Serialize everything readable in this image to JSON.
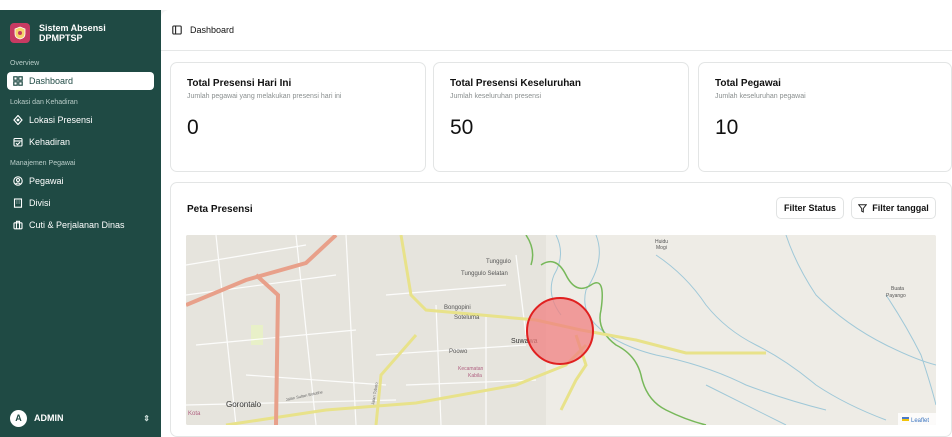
{
  "sidebar": {
    "app_title_line1": "Sistem Absensi",
    "app_title_line2": "DPMPTSP",
    "sections": {
      "overview": "Overview",
      "lokasi": "Lokasi dan Kehadiran",
      "manajemen": "Manajemen Pegawai"
    },
    "items": {
      "dashboard": "Dashboard",
      "lokasi_presensi": "Lokasi Presensi",
      "kehadiran": "Kehadiran",
      "pegawai": "Pegawai",
      "divisi": "Divisi",
      "cuti": "Cuti & Perjalanan Dinas"
    },
    "user": {
      "initial": "A",
      "name": "ADMIN"
    }
  },
  "header": {
    "breadcrumb": "Dashboard"
  },
  "stats": [
    {
      "title": "Total Presensi Hari Ini",
      "subtitle": "Jumlah pegawai yang melakukan presensi hari ini",
      "value": "0"
    },
    {
      "title": "Total Presensi Keseluruhan",
      "subtitle": "Jumlah keseluruhan presensi",
      "value": "50"
    },
    {
      "title": "Total Pegawai",
      "subtitle": "Jumlah keseluruhan pegawai",
      "value": "10"
    }
  ],
  "map_panel": {
    "title": "Peta Presensi",
    "filter_status": "Filter Status",
    "filter_tanggal": "Filter tanggal",
    "attribution": "Leaflet",
    "labels": {
      "tunggulo": "Tunggulo",
      "tunggulo_selatan": "Tunggulo Selatan",
      "bongopini": "Bongopini",
      "soteluma": "Soteluma",
      "poowo": "Poowo",
      "suwawa": "Suwawa",
      "kecamatan": "Kecamatan",
      "kabila": "Kabila",
      "huidu": "Huidu",
      "mogi": "Mogi",
      "buata": "Buata",
      "payango": "Payango",
      "gorontalo": "Gorontalo",
      "kota": "Kota",
      "road1": "Jalan Sultan Botutihe",
      "road2": "Jalan Toboto"
    }
  },
  "colors": {
    "sidebar": "#1f4a44",
    "marker_fill": "#f08080",
    "marker_stroke": "#e02020"
  }
}
